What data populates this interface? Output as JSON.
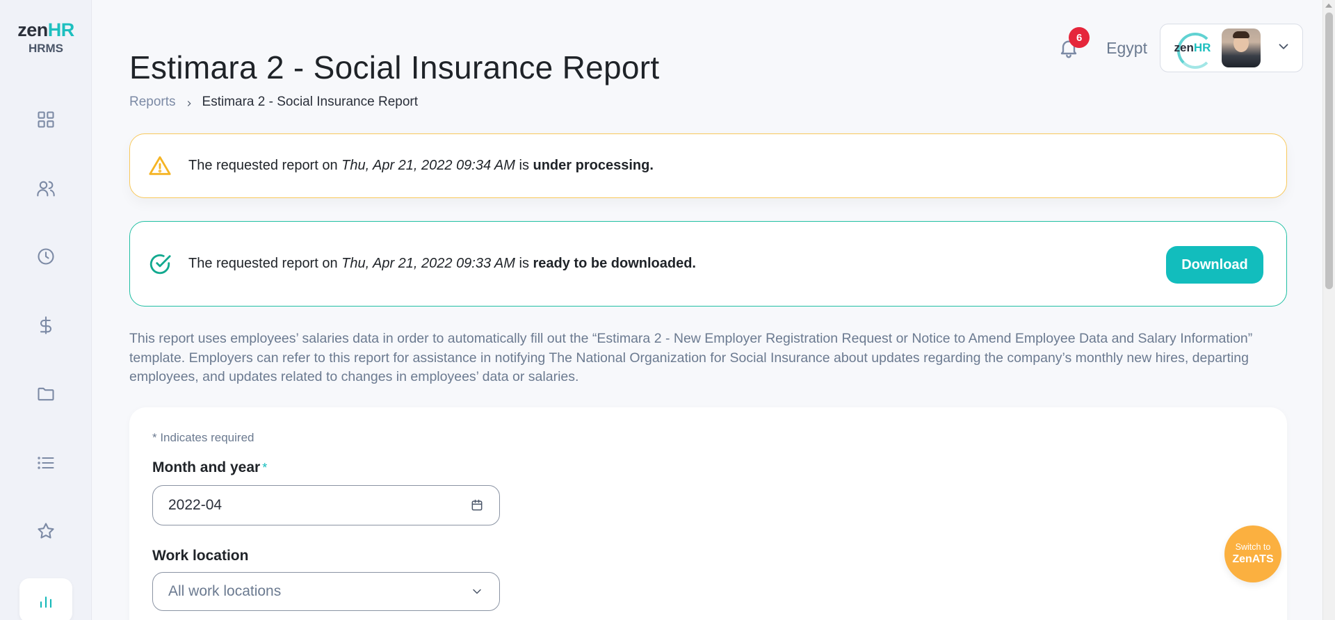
{
  "app": {
    "logo_main": "zen",
    "logo_accent": "HR",
    "logo_sub": "HRMS"
  },
  "sidebar": {
    "items": [
      {
        "name": "dashboard",
        "icon": "grid-icon",
        "active": false
      },
      {
        "name": "employees",
        "icon": "users-icon",
        "active": false
      },
      {
        "name": "attendance",
        "icon": "clock-icon",
        "active": false
      },
      {
        "name": "payroll",
        "icon": "dollar-icon",
        "active": false
      },
      {
        "name": "documents",
        "icon": "folder-icon",
        "active": false
      },
      {
        "name": "requests",
        "icon": "list-icon",
        "active": false
      },
      {
        "name": "performance",
        "icon": "star-icon",
        "active": false
      },
      {
        "name": "reports",
        "icon": "bar-chart-icon",
        "active": true
      }
    ]
  },
  "header": {
    "notification_count": "6",
    "country": "Egypt",
    "company_logo_main": "zen",
    "company_logo_accent": "HR"
  },
  "page": {
    "title": "Estimara 2 - Social Insurance Report",
    "breadcrumb": {
      "parent": "Reports",
      "current": "Estimara 2 - Social Insurance Report"
    }
  },
  "alerts": {
    "processing": {
      "prefix": "The requested report on ",
      "date": "Thu, Apr 21, 2022 09:34 AM",
      "mid": " is ",
      "status": "under processing."
    },
    "ready": {
      "prefix": "The requested report on ",
      "date": "Thu, Apr 21, 2022 09:33 AM",
      "mid": " is ",
      "status": "ready to be downloaded.",
      "button_label": "Download"
    }
  },
  "description": "This report uses employees’ salaries data in order to automatically fill out the “Estimara 2 - New Employer Registration Request or Notice to Amend Employee Data and Salary Information” template. Employers can refer to this report for assistance in notifying The National Organization for Social Insurance about updates regarding the company’s monthly new hires, departing employees, and updates related to changes in employees’ data or salaries.",
  "form": {
    "required_note": "* Indicates required",
    "month_year": {
      "label": "Month and year",
      "required_mark": "*",
      "value": "2022-04"
    },
    "work_location": {
      "label": "Work location",
      "selected": "All work locations"
    }
  },
  "floating": {
    "switch_small": "Switch to",
    "switch_big": "ZenATS"
  },
  "colors": {
    "accent": "#12bdbd",
    "warning": "#f5b424",
    "success": "#12a98f",
    "badge": "#e5263b",
    "ats": "#fbb040"
  }
}
